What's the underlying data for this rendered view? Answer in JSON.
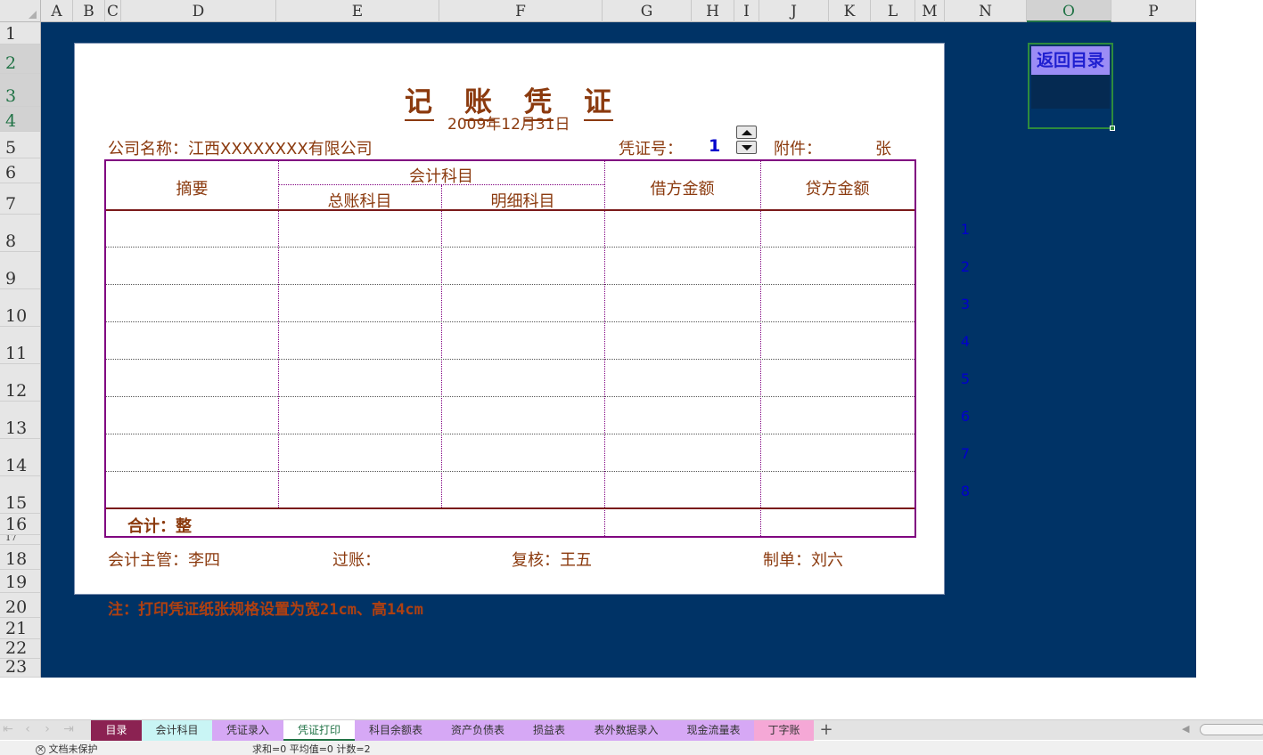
{
  "columns": [
    "A",
    "B",
    "C",
    "D",
    "E",
    "F",
    "G",
    "H",
    "I",
    "J",
    "K",
    "L",
    "M",
    "N",
    "O",
    "P"
  ],
  "rows": [
    "1",
    "2",
    "3",
    "4",
    "5",
    "6",
    "7",
    "8",
    "9",
    "10",
    "11",
    "12",
    "13",
    "14",
    "15",
    "16",
    "17",
    "18",
    "19",
    "20",
    "21",
    "22",
    "23"
  ],
  "voucher": {
    "title": [
      "记",
      "账",
      "凭",
      "证"
    ],
    "date": "2009年12月31日",
    "company": "公司名称：江西XXXXXXXX有限公司",
    "voucher_no_label": "凭证号：",
    "voucher_no": "1",
    "attachment_label": "附件：",
    "attachment_unit": "张",
    "headers": {
      "summary": "摘要",
      "account": "会计科目",
      "general_ledger": "总账科目",
      "detail": "明细科目",
      "debit": "借方金额",
      "credit": "贷方金额"
    },
    "row_numbers": [
      "1",
      "2",
      "3",
      "4",
      "5",
      "6",
      "7",
      "8"
    ],
    "total": "合计：整",
    "signatures": {
      "supervisor": "会计主管：李四",
      "posting": "过账：",
      "review": "复核：王五",
      "preparer": "制单：刘六"
    }
  },
  "note": "注：打印凭证纸张规格设置为宽21cm、高14cm",
  "back_button": "返回目录",
  "tabs": [
    {
      "label": "目录",
      "bg": "#8b2252",
      "color": "#ffffff"
    },
    {
      "label": "会计科目",
      "bg": "#c9f5f5",
      "color": "#333333"
    },
    {
      "label": "凭证录入",
      "bg": "#d6a8f5",
      "color": "#333333"
    },
    {
      "label": "凭证打印",
      "bg": "#ffffff",
      "color": "#217346"
    },
    {
      "label": "科目余额表",
      "bg": "#d6a8f5",
      "color": "#333333"
    },
    {
      "label": "资产负债表",
      "bg": "#d6a8f5",
      "color": "#333333"
    },
    {
      "label": "损益表",
      "bg": "#d6a8f5",
      "color": "#333333"
    },
    {
      "label": "表外数据录入",
      "bg": "#d6a8f5",
      "color": "#333333"
    },
    {
      "label": "现金流量表",
      "bg": "#d6a8f5",
      "color": "#333333"
    },
    {
      "label": "丁字账",
      "bg": "#f5a8d6",
      "color": "#333333"
    }
  ],
  "active_tab": "凭证打印",
  "status": {
    "protect": "文档未保护",
    "stats": "求和=0  平均值=0  计数=2"
  }
}
